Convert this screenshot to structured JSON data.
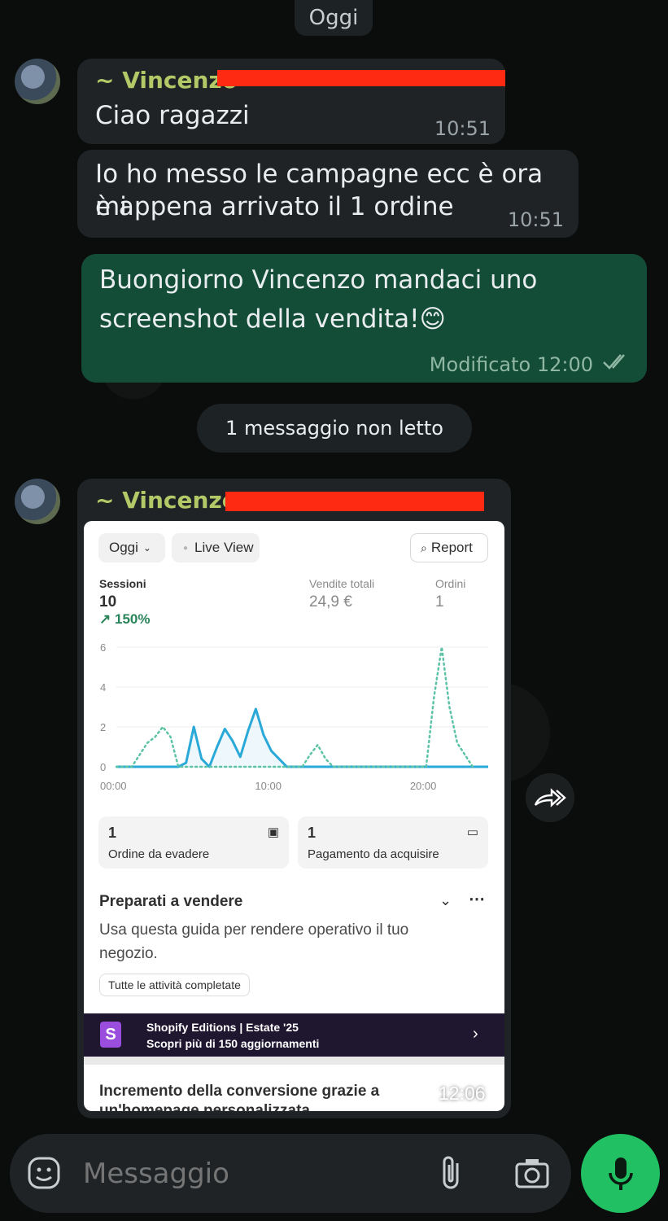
{
  "date_chip": "Oggi",
  "messages": [
    {
      "sender": "~ Vincenzo",
      "text": "Ciao ragazzi",
      "time": "10:51"
    },
    {
      "text_line1": "Io ho messo le campagne ecc è ora mi",
      "text_line2": "è appena arrivato il 1 ordine",
      "time": "10:51"
    },
    {
      "text_line1": "Buongiorno Vincenzo mandaci uno",
      "text_line2": "screenshot della vendita!",
      "emoji": "😊",
      "status": "Modificato 12:00"
    }
  ],
  "unread_label": "1 messaggio non letto",
  "image_message": {
    "sender": "~ Vincenzo",
    "time": "12:06",
    "shot": {
      "date_filter": "Oggi",
      "live_view": "Live View",
      "report": "Report",
      "metrics": [
        {
          "label": "Sessioni",
          "value": "10",
          "delta": "150%"
        },
        {
          "label": "Vendite totali",
          "value": "24,9 €"
        },
        {
          "label": "Ordini",
          "value": "1"
        }
      ],
      "chart_data": {
        "type": "line",
        "x_ticks": [
          "00:00",
          "10:00",
          "20:00"
        ],
        "y_ticks": [
          "6",
          "4",
          "2",
          "0"
        ],
        "ylim": [
          0,
          6
        ],
        "series": [
          {
            "style": "solid",
            "color": "#2aa9d8",
            "x": [
              0,
              2,
              4,
              4.5,
              5,
              5.5,
              6,
              6.5,
              7,
              7.5,
              8,
              8.5,
              9,
              9.5,
              10,
              10.5,
              11,
              11.5,
              12,
              24
            ],
            "y": [
              0,
              0,
              0,
              0.2,
              2,
              0.4,
              0,
              1,
              1.9,
              1.3,
              0.5,
              1.8,
              2.9,
              1.6,
              0.8,
              0.4,
              0,
              0,
              0,
              0
            ]
          },
          {
            "style": "dotted",
            "color": "#5cc3a6",
            "x": [
              0,
              1,
              1.5,
              2,
              2.5,
              3,
              3.5,
              4,
              5,
              12,
              12.5,
              13,
              13.5,
              14,
              19,
              20,
              20.5,
              21,
              21.5,
              22,
              23
            ],
            "y": [
              0,
              0,
              0.6,
              1.2,
              1.5,
              2,
              1.5,
              0,
              0,
              0,
              0.6,
              1.1,
              0.4,
              0,
              0,
              0,
              3.5,
              6,
              3,
              1.2,
              0
            ]
          }
        ]
      },
      "cards": [
        {
          "number": "1",
          "label": "Ordine da evadere"
        },
        {
          "number": "1",
          "label": "Pagamento da acquisire"
        }
      ],
      "guide_title": "Preparati a vendere",
      "guide_text_line1": "Usa questa guida per rendere operativo il tuo",
      "guide_text_line2": "negozio.",
      "guide_badge": "Tutte le attività completate",
      "banner_title": "Shopify Editions | Estate '25",
      "banner_subtitle": "Scopri più di 150 aggiornamenti",
      "footer_text_line1": "Incremento della conversione grazie a",
      "footer_text_line2": "un'homepage personalizzata"
    }
  },
  "composer": {
    "placeholder": "Messaggio"
  },
  "colors": {
    "outgoing": "#144d37",
    "incoming": "#1f2326",
    "accent": "#21c063",
    "sender": "#b3c866"
  }
}
